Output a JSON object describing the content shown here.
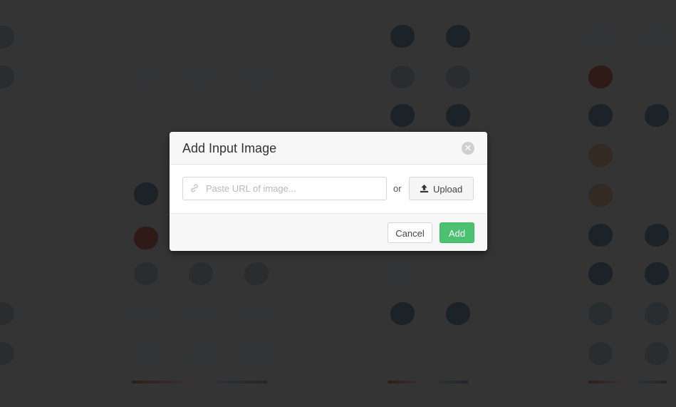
{
  "dialog": {
    "title": "Add Input Image",
    "close_icon": "close-icon",
    "url_input": {
      "value": "",
      "placeholder": "Paste URL of image..."
    },
    "or_label": "or",
    "upload_label": "Upload",
    "cancel_label": "Cancel",
    "add_label": "Add"
  },
  "colors": {
    "add_button": "#4cc170",
    "overlay": "rgba(0,0,0,0.78)"
  }
}
